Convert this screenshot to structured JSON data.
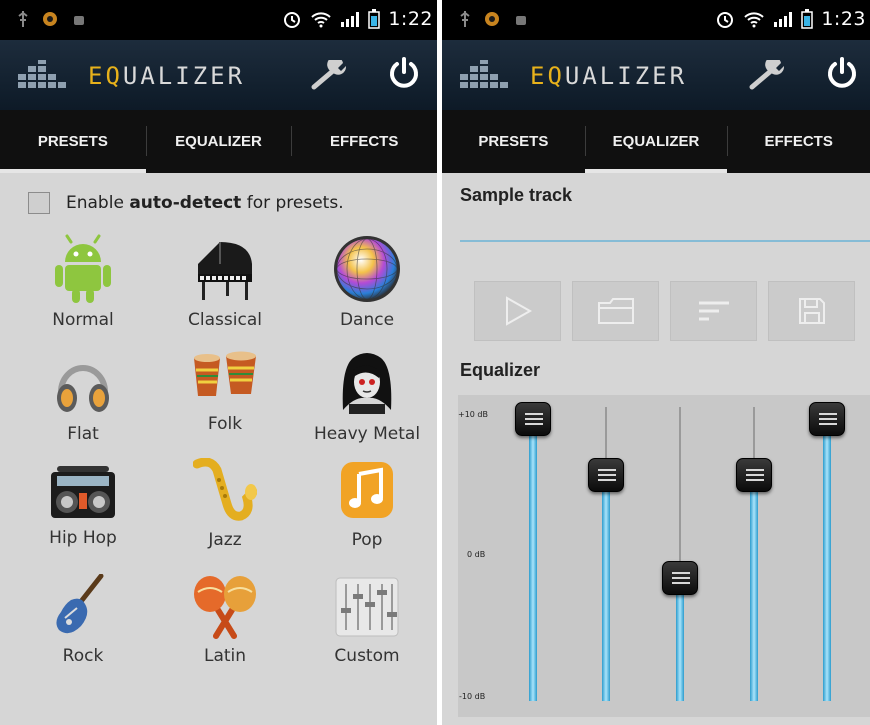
{
  "left_screen": {
    "status_time": "1:22",
    "app_title_highlight": "E",
    "app_title_q": "Q",
    "app_title_rest": "UALIZER",
    "tabs": [
      {
        "label": "PRESETS",
        "active": true
      },
      {
        "label": "EQUALIZER",
        "active": false
      },
      {
        "label": "EFFECTS",
        "active": false
      }
    ],
    "auto_detect": {
      "prefix": "Enable ",
      "bold": "auto-detect",
      "suffix": " for presets.",
      "checked": false
    },
    "presets": [
      {
        "label": "Normal",
        "icon": "android-icon"
      },
      {
        "label": "Classical",
        "icon": "grand-piano-icon"
      },
      {
        "label": "Dance",
        "icon": "disco-ball-icon"
      },
      {
        "label": "Flat",
        "icon": "headphones-icon"
      },
      {
        "label": "Folk",
        "icon": "bongo-drums-icon"
      },
      {
        "label": "Heavy Metal",
        "icon": "metal-head-icon"
      },
      {
        "label": "Hip Hop",
        "icon": "boombox-icon"
      },
      {
        "label": "Jazz",
        "icon": "saxophone-icon"
      },
      {
        "label": "Pop",
        "icon": "music-note-icon"
      },
      {
        "label": "Rock",
        "icon": "electric-guitar-icon"
      },
      {
        "label": "Latin",
        "icon": "maracas-icon"
      },
      {
        "label": "Custom",
        "icon": "mixer-sliders-icon"
      }
    ]
  },
  "right_screen": {
    "status_time": "1:23",
    "app_title_highlight": "E",
    "app_title_q": "Q",
    "app_title_rest": "UALIZER",
    "tabs": [
      {
        "label": "PRESETS",
        "active": false
      },
      {
        "label": "EQUALIZER",
        "active": true
      },
      {
        "label": "EFFECTS",
        "active": false
      }
    ],
    "sample_track_title": "Sample track",
    "controls": [
      "play-icon",
      "folder-icon",
      "list-icon",
      "save-icon"
    ],
    "equalizer_title": "Equalizer",
    "db_labels": {
      "top": "+10 dB",
      "mid": "0 dB",
      "bottom": "-10 dB"
    },
    "bands_db": [
      9.2,
      5.4,
      -1.6,
      5.4,
      9.2
    ]
  },
  "colors": {
    "title_accent": "#e8b21b",
    "eq_fill": "#3eb2e2",
    "tab_bar": "#101010",
    "app_bar": "#15232f"
  }
}
